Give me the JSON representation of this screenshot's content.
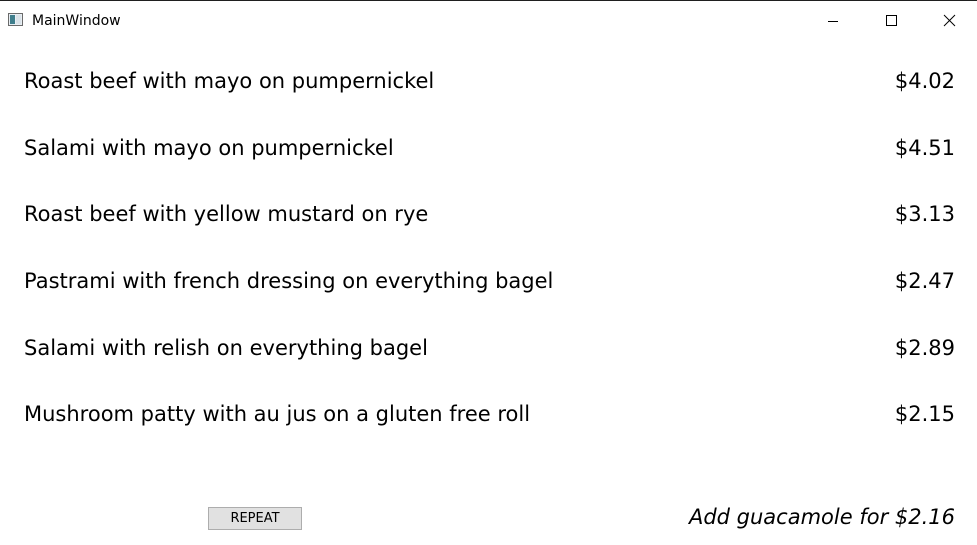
{
  "window": {
    "title": "MainWindow",
    "icon": "app-window-icon",
    "controls": {
      "minimize_icon": "minimize-icon",
      "maximize_icon": "maximize-icon",
      "close_icon": "close-icon"
    }
  },
  "menu": {
    "items": [
      {
        "name": "Roast beef with mayo on pumpernickel",
        "price": "$4.02"
      },
      {
        "name": "Salami with mayo on pumpernickel",
        "price": "$4.51"
      },
      {
        "name": "Roast beef with yellow mustard on rye",
        "price": "$3.13"
      },
      {
        "name": "Pastrami with french dressing on everything bagel",
        "price": "$2.47"
      },
      {
        "name": "Salami with relish on everything bagel",
        "price": "$2.89"
      },
      {
        "name": "Mushroom patty with au jus on a gluten free roll",
        "price": "$2.15"
      }
    ]
  },
  "footer": {
    "repeat_label": "REPEAT",
    "promo_text": "Add guacamole for $2.16"
  },
  "colors": {
    "window_background": "#ffffff",
    "button_background": "#e1e1e1",
    "button_border": "#adadad",
    "text": "#000000"
  }
}
